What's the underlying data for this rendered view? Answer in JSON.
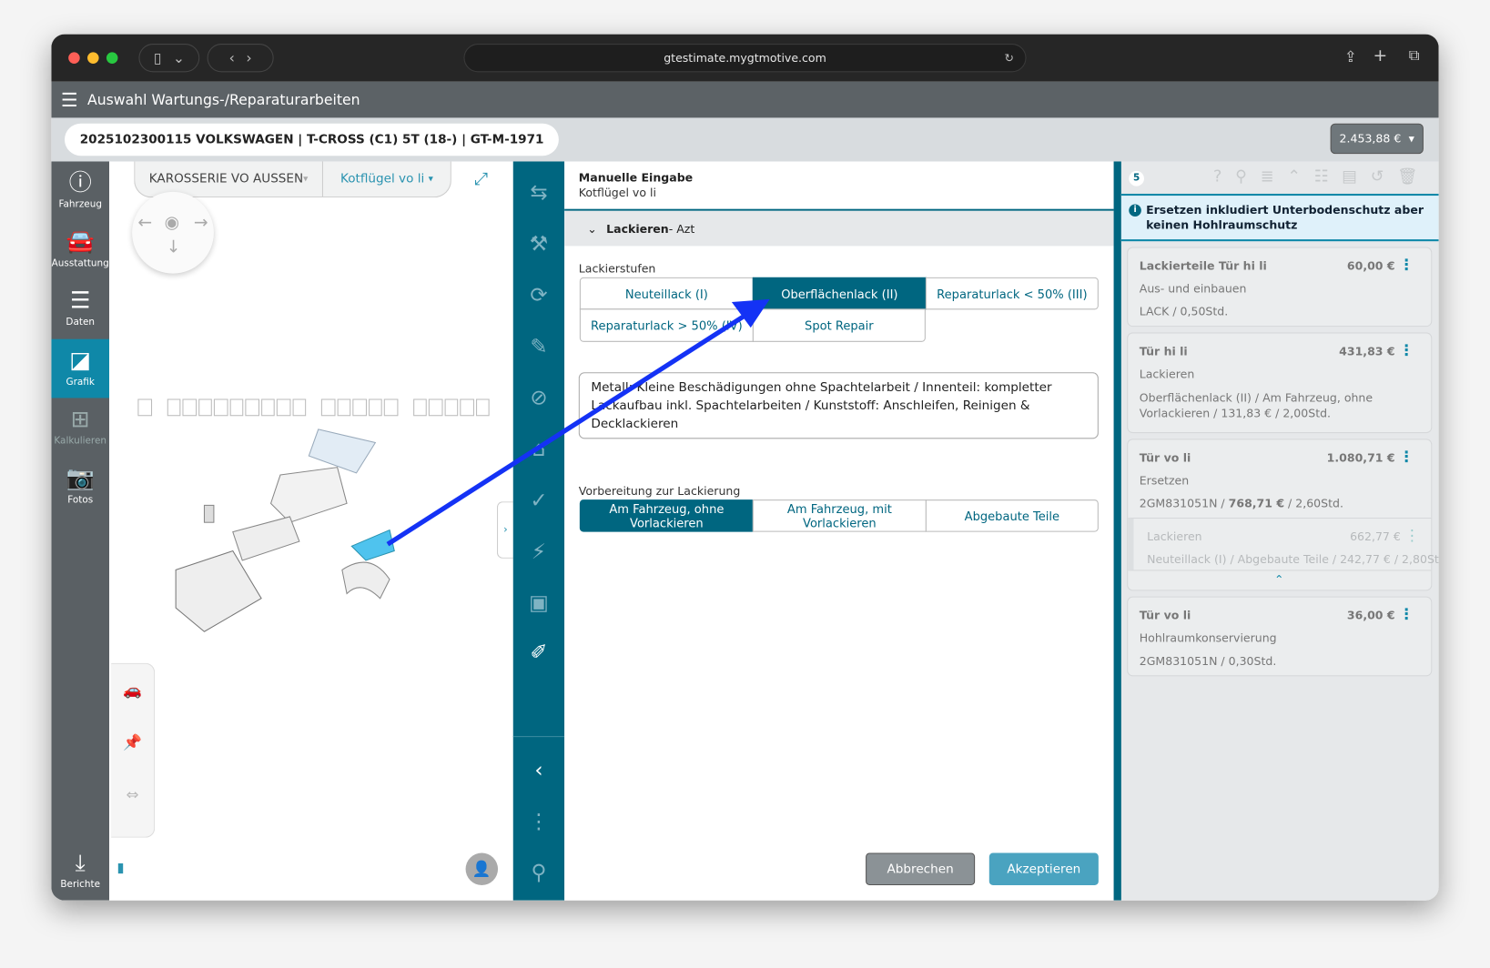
{
  "browser": {
    "url": "gtestimate.mygtmotive.com"
  },
  "app": {
    "title": "Auswahl Wartungs-/Reparaturarbeiten"
  },
  "vehicle": {
    "summary": "2025102300115  VOLKSWAGEN | T-CROSS (C1) 5T (18-) | GT-M-1971",
    "total": "2.453,88 €"
  },
  "sidebar": {
    "items": [
      {
        "label": "Fahrzeug",
        "icon": "info-icon"
      },
      {
        "label": "Ausstattung",
        "icon": "car-icon"
      },
      {
        "label": "Daten",
        "icon": "list-star-icon"
      },
      {
        "label": "Grafik",
        "icon": "door-icon",
        "active": true
      },
      {
        "label": "Kalkulieren",
        "icon": "calculator-icon"
      },
      {
        "label": "Fotos",
        "icon": "camera-icon"
      },
      {
        "label": "Berichte",
        "icon": "report-download-icon"
      }
    ]
  },
  "graphic": {
    "group": "KAROSSERIE VO AUSSEN",
    "part": "Kotflügel vo li"
  },
  "form": {
    "title": "Manuelle Eingabe",
    "subtitle": "Kotflügel vo li",
    "section": "Lackieren",
    "section_suffix": " - Azt",
    "paint_levels_label": "Lackierstufen",
    "paint_levels": [
      "Neuteillack (I)",
      "Oberflächenlack (II)",
      "Reparaturlack < 50% (III)",
      "Reparaturlack > 50% (IV)",
      "Spot Repair"
    ],
    "paint_level_selected": "Oberflächenlack (II)",
    "description": "Metall: Kleine Beschädigungen ohne Spachtelarbeit / Innenteil: kompletter Lackaufbau inkl. Spachtelarbeiten / Kunststoff: Anschleifen, Reinigen & Decklackieren",
    "prep_label": "Vorbereitung zur Lackierung",
    "prep_options": [
      "Am Fahrzeug, ohne Vorlackieren",
      "Am Fahrzeug, mit Vorlackieren",
      "Abgebaute Teile"
    ],
    "prep_selected": "Am Fahrzeug, ohne Vorlackieren",
    "cancel": "Abbrechen",
    "accept": "Akzeptieren"
  },
  "right_panel": {
    "count": "5",
    "notice": "Ersetzen inkludiert Unterbodenschutz aber keinen Hohlraumschutz",
    "items": [
      {
        "title": "Lackierteile Tür hi li",
        "price": "60,00 €",
        "op": "Aus- und einbauen",
        "detail": "LACK / 0,50Std."
      },
      {
        "title": "Tür hi li",
        "price": "431,83 €",
        "op": "Lackieren",
        "detail": "Oberflächenlack (II) / Am Fahrzeug, ohne Vorlackieren / 131,83 € / 2,00Std."
      },
      {
        "title": "Tür vo li",
        "price": "1.080,71 €",
        "op": "Ersetzen",
        "detail_pre": "2GM831051N / ",
        "detail_bold": "768,71 €",
        "detail_post": " / 2,60Std.",
        "sub": {
          "op": "Lackieren",
          "price": "662,77 €",
          "detail": "Neuteillack (I) / Abgebaute Teile / 242,77 € / 2,80Std."
        }
      },
      {
        "title": "Tür vo li",
        "price": "36,00 €",
        "op": "Hohlraumkonservierung",
        "detail": "2GM831051N / 0,30Std."
      }
    ]
  },
  "colors": {
    "primary": "#006680",
    "accent": "#0f88a8",
    "annotation_arrow": "#1432f5"
  }
}
